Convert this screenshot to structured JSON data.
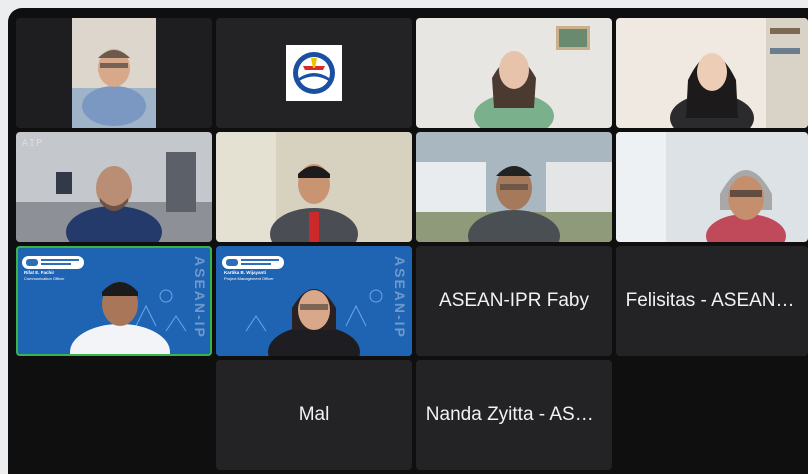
{
  "participants": [
    {
      "id": "p1",
      "name": "",
      "video": true
    },
    {
      "id": "p2",
      "name": "",
      "video": true,
      "icon": "asean-emblem-icon"
    },
    {
      "id": "p3",
      "name": "",
      "video": true
    },
    {
      "id": "p4",
      "name": "",
      "video": true
    },
    {
      "id": "p5",
      "name": "",
      "video": true,
      "brand": "AIP"
    },
    {
      "id": "p6",
      "name": "",
      "video": true
    },
    {
      "id": "p7",
      "name": "",
      "video": true
    },
    {
      "id": "p8",
      "name": "",
      "video": true
    },
    {
      "id": "p9",
      "name": "",
      "video": true,
      "active": true,
      "banner_name": "Rifat E. Fachir",
      "banner_role": "Communication Officer",
      "banner_vertical": "ASEAN-IP"
    },
    {
      "id": "p10",
      "name": "",
      "video": true,
      "banner_name": "Kartika B. Wijayanti",
      "banner_role": "Project Management Officer",
      "banner_vertical": "ASEAN-IP"
    },
    {
      "id": "p11",
      "name": "ASEAN-IPR Faby",
      "video": false
    },
    {
      "id": "p12",
      "name": "Felisitas - ASEAN I...",
      "video": false
    },
    {
      "id": "p13",
      "name": "Mal",
      "video": false
    },
    {
      "id": "p14",
      "name": "Nanda Zyitta - ASE...",
      "video": false
    }
  ],
  "colors": {
    "background": "#0f0f10",
    "tile": "#232325",
    "active_speaker": "#38b44a",
    "banner_blue": "#1f63b3"
  }
}
